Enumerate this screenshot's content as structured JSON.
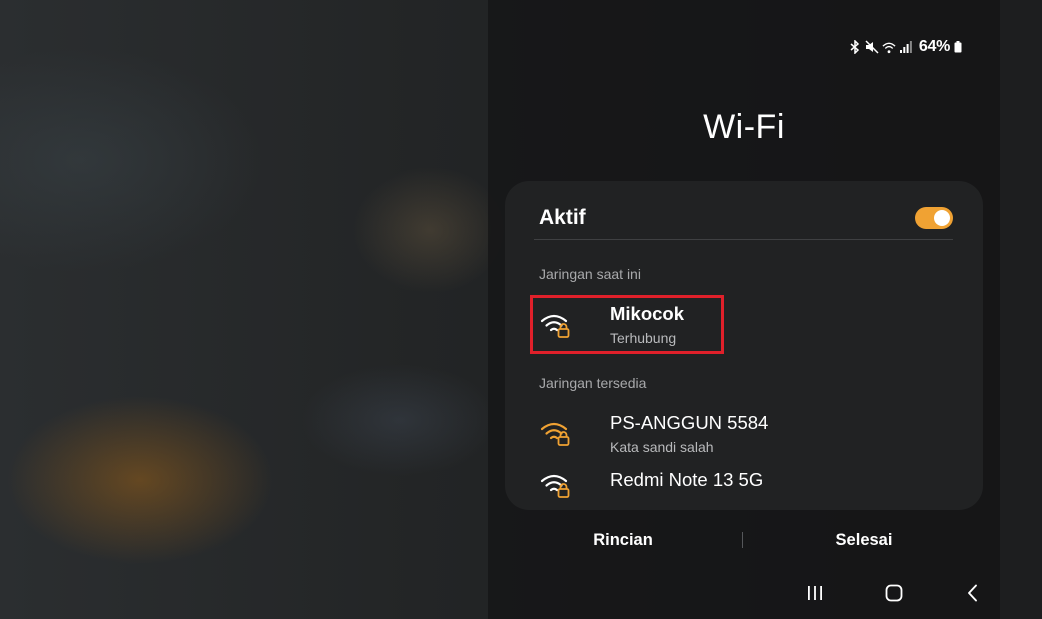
{
  "status_bar": {
    "icons": [
      "bluetooth-icon",
      "mute-icon",
      "wifi-icon",
      "signal-icon",
      "battery-icon"
    ],
    "battery_percent": "64%"
  },
  "title": "Wi-Fi",
  "wifi": {
    "toggle_label": "Aktif",
    "toggle_on": true
  },
  "current_section": "Jaringan saat ini",
  "current_network": {
    "name": "Mikocok",
    "status": "Terhubung",
    "icon": "wifi-lock-icon"
  },
  "available_section": "Jaringan tersedia",
  "available_networks": [
    {
      "name": "PS-ANGGUN 5584",
      "status": "Kata sandi salah",
      "icon": "wifi-lock-icon"
    },
    {
      "name": "Redmi Note 13 5G",
      "status": "",
      "icon": "wifi-lock-icon"
    }
  ],
  "buttons": {
    "details": "Rincian",
    "done": "Selesai"
  },
  "nav_bar": {
    "icons": [
      "recent-apps-icon",
      "home-icon",
      "back-icon"
    ]
  },
  "colors": {
    "accent": "#f0a233",
    "highlight": "#e0202a",
    "card": "#212223"
  }
}
